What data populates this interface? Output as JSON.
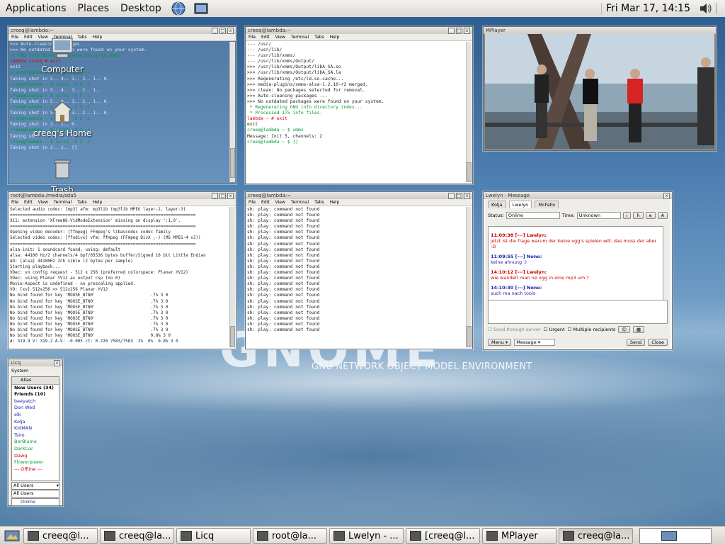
{
  "panel": {
    "menus": [
      "Applications",
      "Places",
      "Desktop"
    ],
    "clock": "Fri Mar 17, 14:15"
  },
  "desktop_icons": [
    "Computer",
    "creeq's Home",
    "Trash"
  ],
  "gnome": {
    "logo": "GNOME",
    "tagline": "GNU NETWORK OBJECT MODEL ENVIRONMENT"
  },
  "term_menu": [
    "File",
    "Edit",
    "View",
    "Terminal",
    "Tabs",
    "Help"
  ],
  "term1": {
    "title": "creeq@lambda:~",
    "lines": [
      ">>> Auto-cleaning packages ...",
      "",
      ">>> No outdated packages were found on your system.",
      "",
      " * GNU info directory index is up-to-date.",
      "",
      "lambda creeq # exit",
      "exit",
      "creeq@lambda ~ $ scrot -d 5 -c",
      "Taking shot in 5.. 4.. 3.. 2.. 1.. 0.",
      "creeq@lambda ~ $ scrot -d 5 -c",
      "Taking shot in 5.. 4.. 3.. 2.. 1..",
      "creeq@lambda ~ $ scrot -d 5 -c",
      "Taking shot in 5.. 4.. 3.. 2.. 1.. 0.",
      "creeq@lambda ~ $ scrot -d 5 -c",
      "Taking shot in 5.. 4.. 3.. 2.. 1.. 0.",
      "creeq@lambda ~ $ scrot -d 2 -c",
      "Taking shot in 2.. 1.. 0.",
      "creeq@lambda ~ $ scrot -d 2 -c",
      "Taking shot in 2.. 1.. 0.",
      "creeq@lambda ~ $ scrot -d 2 -c",
      "Taking shot in 2.. 1.. []"
    ]
  },
  "term2": {
    "title": "creeq@lambda:~",
    "lines": [
      "--- /usr/",
      "--- /usr/lib/",
      "--- /usr/lib/xmms/",
      "--- /usr/lib/xmms/Output/",
      ">>> /usr/lib/xmms/Output/libA_SA.so",
      ">>> /usr/lib/xmms/Output/libA_SA.la",
      ">>> Regenerating /etc/ld.so.cache...",
      ">>> media-plugins/xmms-alsa-1.2.10-r2 merged.",
      "",
      ">>> clean: No packages selected for removal.",
      "",
      ">>> Auto-cleaning packages ...",
      "",
      ">>> No outdated packages were found on your system.",
      "",
      "",
      " * Regenerating GNU info directory index...",
      " * Processed 175 info files.",
      "",
      "lambda ~ # exit",
      "exit",
      "creeq@lambda ~ $ xmms",
      "Message: Init 5, channels: 2",
      "creeq@lambda ~ $ []"
    ]
  },
  "term3": {
    "title": "root@lambda:/media/sda5",
    "lines": [
      "Selected audio codec: [mp3] afm: mp3lib (mp3lib MPEG layer-2, layer-3)",
      "==========================================================================",
      "X11: extension 'XFree86-VidModeExtension' missing on display ':1.0'.",
      "==========================================================================",
      "Opening video decoder: [ffmpeg] FFmpeg's libavcodec codec family",
      "Selected video codec: [ffodivx] vfm: ffmpeg (FFmpeg DivX ;-) (MS MPEG-4 v3))",
      "==========================================================================",
      "alsa-init: 1 soundcard found, using: default",
      "alsa: 44100 Hz/2 channels/4 bpf/65536 bytes buffer/Signed 16 bit Little Endian",
      "AO: [alsa] 44100Hz 2ch s16le (2 bytes per sample)",
      "Starting playback...",
      "VDec: vo config request - 512 x 256 (preferred colorspace: Planar YV12)",
      "VDec: using Planar YV12 as output csp (no 0)",
      "Movie-Aspect is undefined - no prescaling applied.",
      "VO: [xv] 512x256 => 512x256 Planar YV12",
      "No bind found for key 'MOUSE_BTN0'                      .7% 3 0",
      "No bind found for key 'MOUSE_BTN0'                      .7% 3 0",
      "No bind found for key 'MOUSE_BTN0'                      .7% 3 0",
      "No bind found for key 'MOUSE_BTN0'                      .7% 3 0",
      "No bind found for key 'MOUSE_BTN0'                      .7% 3 0",
      "No bind found for key 'MOUSE_BTN0'                      .7% 3 0",
      "No bind found for key 'MOUSE_BTN0'                      .7% 3 0",
      "No bind found for key 'MOUSE_BTN0'                      0.8% 3 0",
      "A: 319.9 V: 319.2 A-V: -0.005 ct: 0.220 7583/7583  2%  0%  0.8% 3 0"
    ]
  },
  "term4": {
    "title": "creeq@lambda:~",
    "line": "sh: play: command not found",
    "count": 22
  },
  "mplayer": {
    "title": "MPlayer"
  },
  "message": {
    "title": "Lwelyn - Message",
    "tabs": [
      "Kolja",
      "Lwelyn",
      "McFallo"
    ],
    "status_label": "Status:",
    "status_value": "Online",
    "time_label": "Time:",
    "time_value": "Unknown",
    "history": [
      {
        "head": "11:09:38 [---] Lwelyn:",
        "text": "jetzt ist die frage warum der keine ogg's spielen will..das muss der aber :D",
        "color": "#c00"
      },
      {
        "head": "11:09:55 [---] None:",
        "text": "keine ahnung :)",
        "color": "#22a"
      },
      {
        "head": "14:10:12 [---] Lwelyn:",
        "text": "wie wandelt man ne ogg in eine mp3 um ?",
        "color": "#c00"
      },
      {
        "head": "14:10:30 [---] None:",
        "text": "such ma nach tools",
        "color": "#22a"
      }
    ],
    "send_through_server": "Send through server",
    "urgent": "Urgent",
    "multiple": "Multiple recipients",
    "menu": "Menu",
    "type": "Message",
    "send": "Send",
    "close": "Close"
  },
  "licq": {
    "title": "Licq",
    "system": "System",
    "alias_header": "Alias",
    "contacts": [
      {
        "name": "New Users (34)",
        "color": "#000",
        "bold": true
      },
      {
        "name": "Friends (10)",
        "color": "#000",
        "bold": true
      },
      {
        "name": "beeyatch",
        "color": "#22a"
      },
      {
        "name": "Don Wed",
        "color": "#22a"
      },
      {
        "name": "elk",
        "color": "#22a"
      },
      {
        "name": "Kolja",
        "color": "#22a"
      },
      {
        "name": "KidMAN",
        "color": "#22a"
      },
      {
        "name": "Tsiro",
        "color": "#22a"
      },
      {
        "name": "BerBlume",
        "color": "#093"
      },
      {
        "name": "DarkCor",
        "color": "#093"
      },
      {
        "name": "Dawg",
        "color": "#c00"
      },
      {
        "name": "Flowerpower",
        "color": "#093"
      },
      {
        "name": "--- Offline ---",
        "color": "#c00"
      }
    ],
    "group": "All Users",
    "group2": "All Users",
    "status": "Online"
  },
  "taskbar": [
    {
      "label": "creeq@l...",
      "active": false
    },
    {
      "label": "creeq@la...",
      "active": false
    },
    {
      "label": "Licq",
      "active": false
    },
    {
      "label": "root@la...",
      "active": false
    },
    {
      "label": "Lwelyn - ...",
      "active": false
    },
    {
      "label": "[creeq@l...",
      "active": false
    },
    {
      "label": "MPlayer",
      "active": false
    },
    {
      "label": "creeq@la...",
      "active": true
    }
  ]
}
